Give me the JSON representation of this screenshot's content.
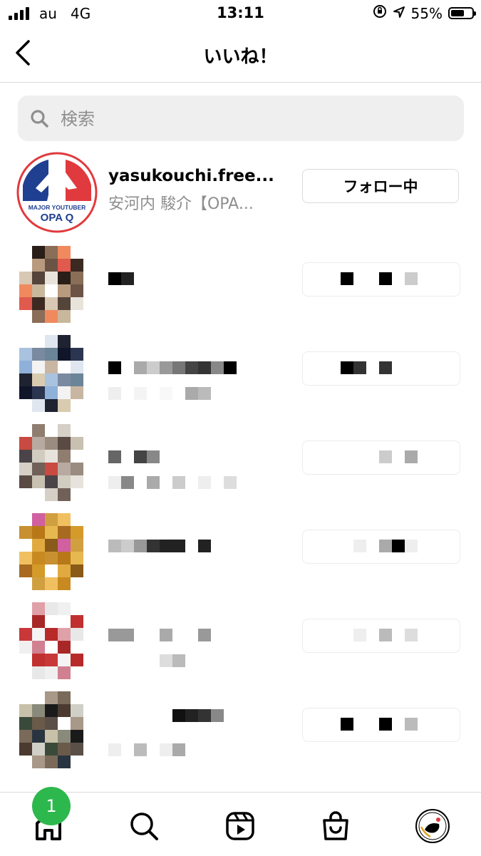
{
  "status_bar": {
    "carrier": "au",
    "network": "4G",
    "time": "13:11",
    "battery": "55%"
  },
  "header": {
    "title": "いいね！",
    "back_icon": "chevron-left-icon"
  },
  "search": {
    "placeholder": "検索",
    "icon": "search-icon"
  },
  "likers": [
    {
      "username": "yasukouchi.free...",
      "full_name": "安河内 駿介【OPA...",
      "button": "フォロー中",
      "avatar_texts": {
        "top": "MAJOR YOUTUBER",
        "bottom": "OPA Q"
      }
    }
  ],
  "blurred_rows": 7,
  "tab_bar": {
    "items": [
      "home-icon",
      "search-icon",
      "reels-icon",
      "shop-icon",
      "profile-icon"
    ],
    "notification_count": "1"
  },
  "colors": {
    "accent": "#2db84d",
    "logo_red": "#e03a3e",
    "logo_blue": "#1f3f91"
  }
}
